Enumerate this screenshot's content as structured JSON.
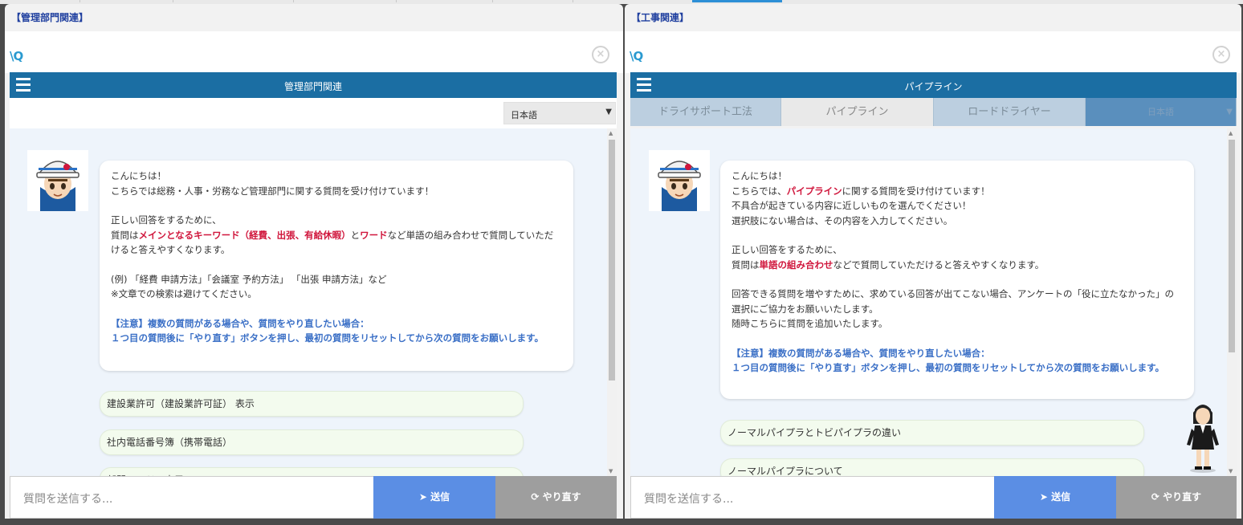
{
  "left": {
    "panel_title": "【管理部門関連】",
    "logo": "\\Q",
    "header_title": "管理部門関連",
    "language": "日本語",
    "greeting": {
      "line1": "こんにちは！",
      "line2": "こちらでは総務・人事・労務など管理部門に関する質問を受け付けています！",
      "line3": "正しい回答をするために、",
      "line4_a": "質問は",
      "line4_b": "メインとなるキーワード（経費、出張、有給休暇）",
      "line4_c": "と",
      "line4_d": "ワード",
      "line4_e": "など単語の組み合わせで質問していただけると答えやすくなります。",
      "line5": "(例) 「経費 申請方法」「会議室 予約方法」 「出張 申請方法」など",
      "line6": "※文章での検索は避けてください。",
      "note1": "【注意】複数の質問がある場合や、質問をやり直したい場合：",
      "note2": "１つ目の質問後に「やり直す」ボタンを押し、最初の質問をリセットしてから次の質問をお願いします。"
    },
    "choices": [
      "建設業許可（建設業許可証） 表示",
      "社内電話番号簿（携帯電話）",
      "部門コードの表示"
    ],
    "input_placeholder": "質問を送信する...",
    "send_label": "送信",
    "retry_label": "やり直す"
  },
  "right": {
    "panel_title": "【工事関連】",
    "logo": "\\Q",
    "header_title": "パイプライン",
    "tabs": [
      "ドライサポート工法",
      "パイプライン",
      "ロードドライヤー",
      "日本語"
    ],
    "greeting": {
      "line1": "こんにちは！",
      "line2_a": "こちらでは、",
      "line2_b": "パイプライン",
      "line2_c": "に関する質問を受け付けています！",
      "line3": "不具合が起きている内容に近しいものを選んでください！",
      "line4": "選択肢にない場合は、その内容を入力してください。",
      "line5": "正しい回答をするために、",
      "line6_a": "質問は",
      "line6_b": "単語の組み合わせ",
      "line6_c": "などで質問していただけると答えやすくなります。",
      "line7": "回答できる質問を増やすために、求めている回答が出てこない場合、アンケートの「役に立たなかった」の選択にご協力をお願いいたします。",
      "line8": "随時こちらに質問を追加いたします。",
      "note1": "【注意】複数の質問がある場合や、質問をやり直したい場合：",
      "note2": "１つ目の質問後に「やり直す」ボタンを押し、最初の質問をリセットしてから次の質問をお願いします。"
    },
    "choices": [
      "ノーマルパイプラとトビパイプラの違い",
      "ノーマルパイプラについて"
    ],
    "input_placeholder": "質問を送信する...",
    "send_label": "送信",
    "retry_label": "やり直す"
  },
  "icons": {
    "close": "close-icon",
    "menu": "hamburger-icon",
    "send": "paper-plane-icon",
    "retry": "refresh-icon",
    "avatar": "helmet-worker-avatar",
    "assistant": "businesswoman-figure"
  },
  "colors": {
    "header": "#1b6ea3",
    "send": "#5b8ee4",
    "retry": "#9e9e9e",
    "emphasis_red": "#d0163c",
    "note_blue": "#3a6fc6"
  }
}
